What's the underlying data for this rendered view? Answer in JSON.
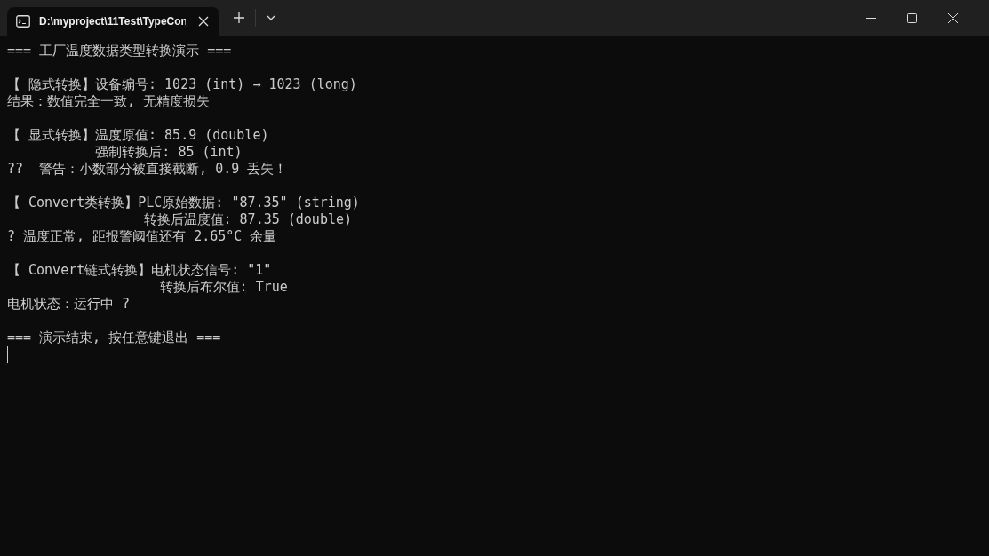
{
  "window": {
    "tab_title": "D:\\myproject\\11Test\\TypeCon"
  },
  "console": {
    "blocks": [
      [
        "=== 工厂温度数据类型转换演示 ==="
      ],
      [
        "【 隐式转换】设备编号: 1023 (int) → 1023 (long)",
        "结果：数值完全一致, 无精度损失"
      ],
      [
        "【 显式转换】温度原值: 85.9 (double)",
        "           强制转换后: 85 (int)",
        "??  警告：小数部分被直接截断, 0.9 丢失！"
      ],
      [
        "【 Convert类转换】PLC原始数据: \"87.35\" (string)",
        "                 转换后温度值: 87.35 (double)",
        "? 温度正常, 距报警阈值还有 2.65°C 余量"
      ],
      [
        "【 Convert链式转换】电机状态信号: \"1\"",
        "                   转换后布尔值: True",
        "电机状态：运行中 ?"
      ],
      [
        "=== 演示结束, 按任意键退出 ==="
      ]
    ]
  }
}
